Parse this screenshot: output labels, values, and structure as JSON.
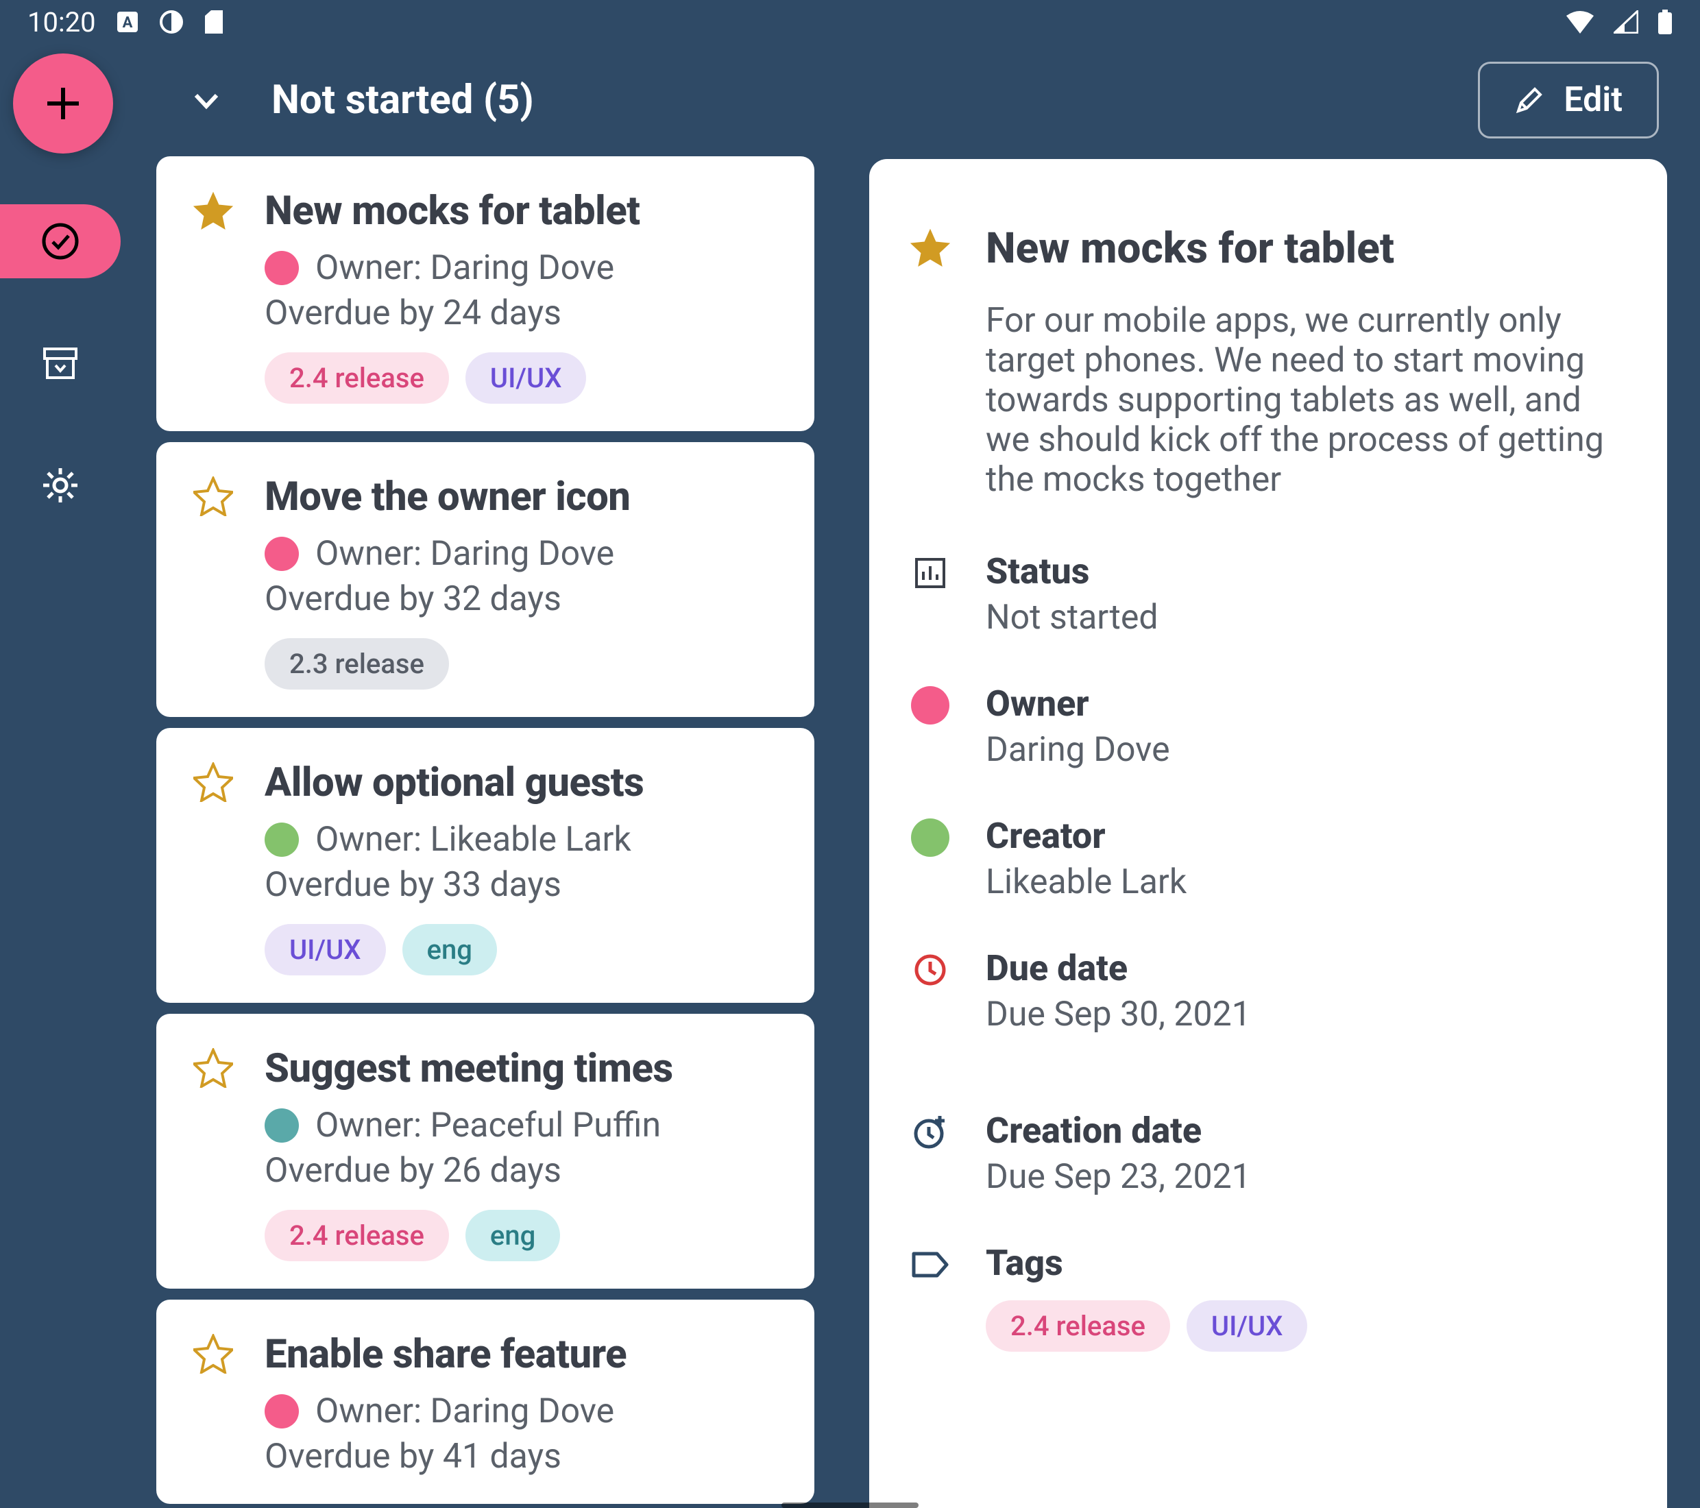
{
  "status_bar": {
    "time": "10:20"
  },
  "header": {
    "title": "Not started (5)",
    "edit_label": "Edit"
  },
  "tag_style": {
    "2.4 release": "tag-pink",
    "2.3 release": "tag-grey",
    "UI/UX": "tag-purple",
    "eng": "tag-teal"
  },
  "tasks": [
    {
      "title": "New mocks for tablet",
      "starred": true,
      "owner": "Daring Dove",
      "owner_color": "av-pink",
      "due": "Overdue by 24 days",
      "tags": [
        "2.4 release",
        "UI/UX"
      ]
    },
    {
      "title": "Move the owner icon",
      "starred": false,
      "owner": "Daring Dove",
      "owner_color": "av-pink",
      "due": "Overdue by 32 days",
      "tags": [
        "2.3 release"
      ]
    },
    {
      "title": "Allow optional guests",
      "starred": false,
      "owner": "Likeable Lark",
      "owner_color": "av-green",
      "due": "Overdue by 33 days",
      "tags": [
        "UI/UX",
        "eng"
      ]
    },
    {
      "title": "Suggest meeting times",
      "starred": false,
      "owner": "Peaceful Puffin",
      "owner_color": "av-teal",
      "due": "Overdue by 26 days",
      "tags": [
        "2.4 release",
        "eng"
      ]
    },
    {
      "title": "Enable share feature",
      "starred": false,
      "owner": "Daring Dove",
      "owner_color": "av-pink",
      "due": "Overdue by 41 days",
      "tags": []
    }
  ],
  "detail": {
    "title": "New mocks for tablet",
    "starred": true,
    "description": "For our mobile apps, we currently only target phones. We need to start moving towards supporting tablets as well, and we should kick off the process of getting the mocks together",
    "status_label": "Status",
    "status_value": "Not started",
    "owner_label": "Owner",
    "owner_value": "Daring Dove",
    "creator_label": "Creator",
    "creator_value": "Likeable Lark",
    "due_label": "Due date",
    "due_value": "Due Sep 30, 2021",
    "created_label": "Creation date",
    "created_value": "Due Sep 23, 2021",
    "tags_label": "Tags",
    "tags": [
      "2.4 release",
      "UI/UX"
    ]
  }
}
